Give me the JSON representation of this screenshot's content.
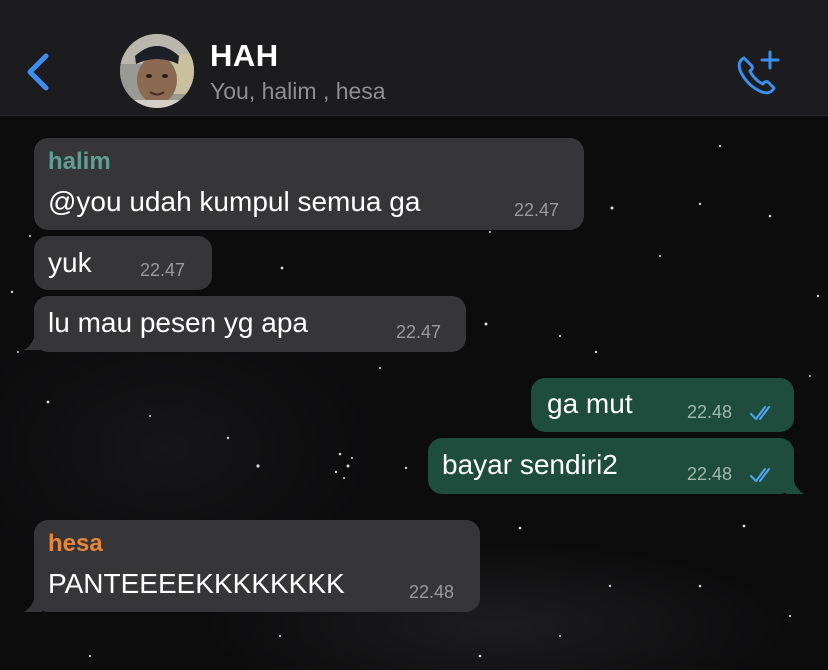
{
  "header": {
    "title": "HAH",
    "subtitle": "You, halim , hesa"
  },
  "colors": {
    "accent": "#3b8ff0",
    "incoming_bubble": "#363638",
    "outgoing_bubble": "#1e4d3d",
    "halim_name": "#5e9e93",
    "hesa_name": "#e8853c",
    "read_ticks": "#4ea6f5"
  },
  "messages": [
    {
      "sender": "halim",
      "text": "@you udah kumpul semua ga",
      "time": "22.47",
      "direction": "in"
    },
    {
      "text": "yuk",
      "time": "22.47",
      "direction": "in"
    },
    {
      "text": "lu mau pesen yg apa",
      "time": "22.47",
      "direction": "in"
    },
    {
      "text": "ga mut",
      "time": "22.48",
      "direction": "out",
      "status": "read"
    },
    {
      "text": "bayar sendiri2",
      "time": "22.48",
      "direction": "out",
      "status": "read"
    },
    {
      "sender": "hesa",
      "text": "PANTEEEEKKKKKKKK",
      "time": "22.48",
      "direction": "in"
    }
  ],
  "icons": {
    "back": "chevron-left-icon",
    "call": "add-call-icon",
    "avatar": "group-avatar",
    "read": "double-check-icon"
  }
}
